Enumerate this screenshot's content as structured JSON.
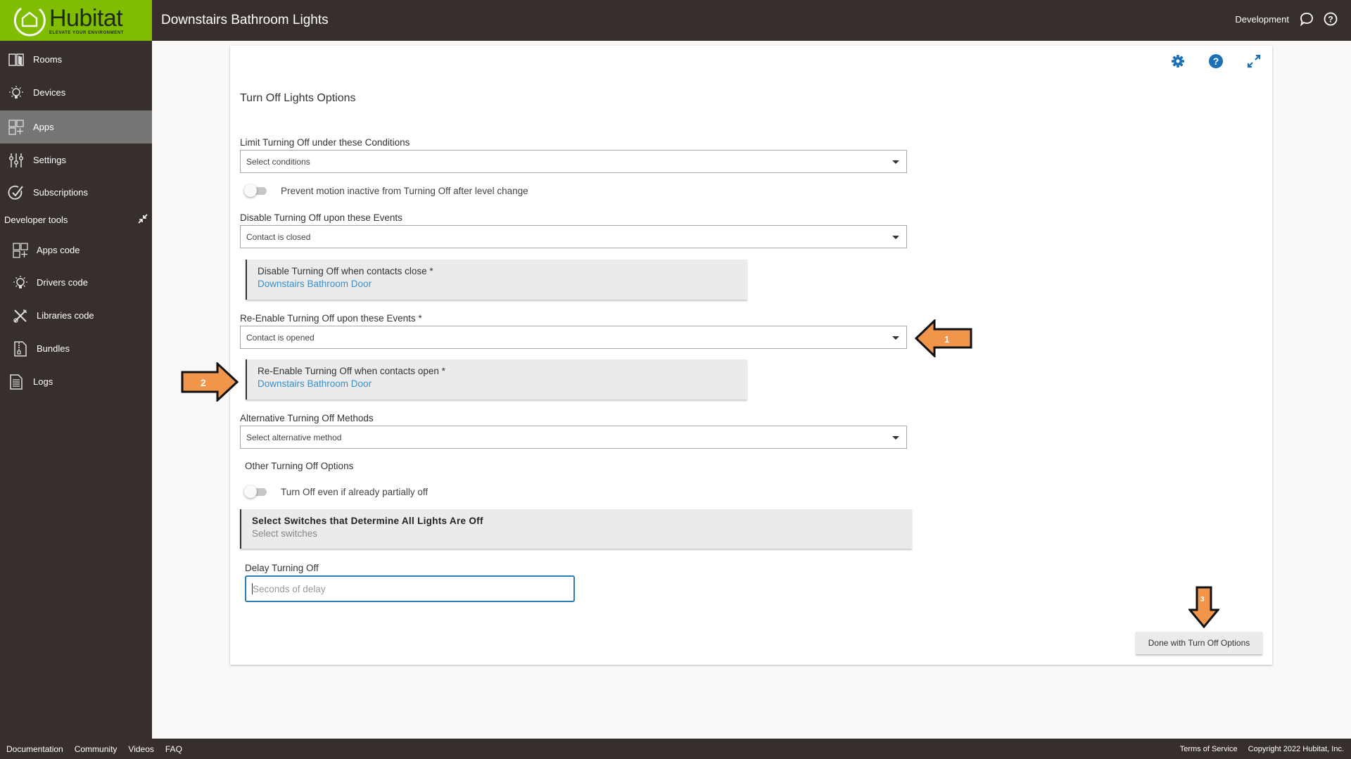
{
  "header": {
    "brand": "Hubitat",
    "tagline": "ELEVATE YOUR ENVIRONMENT",
    "title": "Downstairs Bathroom Lights",
    "environment": "Development",
    "icons": [
      "chat-bubble-icon",
      "help-circle-icon"
    ]
  },
  "sidebar": {
    "items": [
      {
        "label": "Rooms",
        "icon": "rooms-icon",
        "active": false
      },
      {
        "label": "Devices",
        "icon": "lightbulb-icon",
        "active": false
      },
      {
        "label": "Apps",
        "icon": "apps-grid-icon",
        "active": true
      },
      {
        "label": "Settings",
        "icon": "sliders-icon",
        "active": false
      },
      {
        "label": "Subscriptions",
        "icon": "check-circle-icon",
        "active": false
      }
    ],
    "developer_tools": {
      "label": "Developer tools",
      "items": [
        {
          "label": "Apps code",
          "icon": "apps-grid-icon"
        },
        {
          "label": "Drivers code",
          "icon": "lightbulb-icon"
        },
        {
          "label": "Libraries code",
          "icon": "tools-icon"
        },
        {
          "label": "Bundles",
          "icon": "zip-file-icon"
        },
        {
          "label": "Logs",
          "icon": "document-icon"
        }
      ]
    }
  },
  "card": {
    "tools": [
      "gear-icon",
      "help-icon",
      "expand-icon"
    ],
    "section_title": "Turn Off Lights Options",
    "limit_conditions": {
      "label": "Limit Turning Off under these Conditions",
      "placeholder": "Select conditions"
    },
    "prevent_motion_toggle": {
      "label": "Prevent motion inactive from Turning Off after level change",
      "on": false
    },
    "disable_events": {
      "label": "Disable Turning Off upon these Events",
      "value": "Contact is closed"
    },
    "disable_contacts": {
      "title": "Disable Turning Off when contacts close *",
      "value": "Downstairs Bathroom Door"
    },
    "reenable_events": {
      "label": "Re-Enable Turning Off upon these Events *",
      "value": "Contact is opened"
    },
    "reenable_contacts": {
      "title": "Re-Enable Turning Off when contacts open *",
      "value": "Downstairs Bathroom Door"
    },
    "alternative_methods": {
      "label": "Alternative Turning Off Methods",
      "placeholder": "Select alternative method"
    },
    "other_options": {
      "label": "Other Turning Off Options"
    },
    "partially_off_toggle": {
      "label": "Turn Off even if already partially off",
      "on": false
    },
    "switches_box": {
      "title": "Select Switches that Determine All Lights Are Off",
      "placeholder": "Select switches"
    },
    "delay": {
      "label": "Delay Turning Off",
      "placeholder": "Seconds of delay",
      "value": ""
    },
    "done_button": "Done with Turn Off Options"
  },
  "annotations": [
    {
      "number": "1",
      "direction": "left",
      "color": "#f0954a"
    },
    {
      "number": "2",
      "direction": "right",
      "color": "#f0954a"
    },
    {
      "number": "3",
      "direction": "down",
      "color": "#f0954a"
    }
  ],
  "footer": {
    "links": [
      "Documentation",
      "Community",
      "Videos",
      "FAQ"
    ],
    "terms": "Terms of Service",
    "copyright": "Copyright 2022 Hubitat, Inc."
  },
  "colors": {
    "brand_green": "#80bc00",
    "chrome_dark": "#362f2d",
    "active_nav": "#777574",
    "link_blue": "#3a8fc8",
    "tool_blue": "#1a6fb5"
  }
}
